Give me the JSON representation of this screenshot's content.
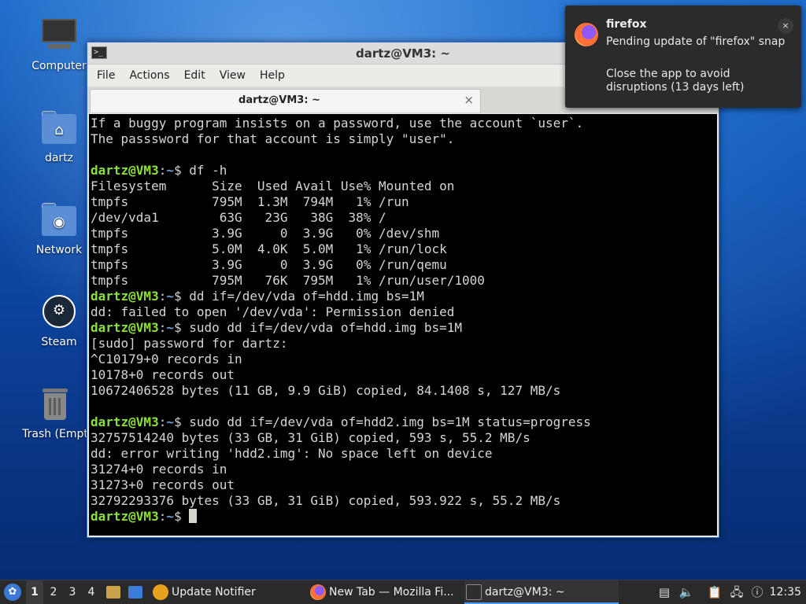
{
  "desktop": {
    "icons": [
      {
        "label": "Computer",
        "icon": "computer-icon"
      },
      {
        "label": "dartz",
        "icon": "home-folder-icon"
      },
      {
        "label": "Network",
        "icon": "network-folder-icon"
      },
      {
        "label": "Steam",
        "icon": "steam-icon"
      },
      {
        "label": "Trash (Empt",
        "icon": "trash-icon"
      }
    ]
  },
  "window": {
    "title": "dartz@VM3: ~",
    "menu": [
      "File",
      "Actions",
      "Edit",
      "View",
      "Help"
    ],
    "tab_label": "dartz@VM3: ~",
    "tab_close": "×"
  },
  "terminal": {
    "prompt_user": "dartz@VM3",
    "prompt_path": "~",
    "lines": [
      {
        "text": "If a buggy program insists on a password, use the account `user`."
      },
      {
        "text": "The passsword for that account is simply \"user\"."
      },
      {
        "text": ""
      },
      {
        "prompt": true,
        "text": " df -h"
      },
      {
        "text": "Filesystem      Size  Used Avail Use% Mounted on"
      },
      {
        "text": "tmpfs           795M  1.3M  794M   1% /run"
      },
      {
        "text": "/dev/vda1        63G   23G   38G  38% /"
      },
      {
        "text": "tmpfs           3.9G     0  3.9G   0% /dev/shm"
      },
      {
        "text": "tmpfs           5.0M  4.0K  5.0M   1% /run/lock"
      },
      {
        "text": "tmpfs           3.9G     0  3.9G   0% /run/qemu"
      },
      {
        "text": "tmpfs           795M   76K  795M   1% /run/user/1000"
      },
      {
        "prompt": true,
        "text": " dd if=/dev/vda of=hdd.img bs=1M"
      },
      {
        "text": "dd: failed to open '/dev/vda': Permission denied"
      },
      {
        "prompt": true,
        "text": " sudo dd if=/dev/vda of=hdd.img bs=1M"
      },
      {
        "text": "[sudo] password for dartz:"
      },
      {
        "text": "^C10179+0 records in"
      },
      {
        "text": "10178+0 records out"
      },
      {
        "text": "10672406528 bytes (11 GB, 9.9 GiB) copied, 84.1408 s, 127 MB/s"
      },
      {
        "text": ""
      },
      {
        "prompt": true,
        "text": " sudo dd if=/dev/vda of=hdd2.img bs=1M status=progress"
      },
      {
        "text": "32757514240 bytes (33 GB, 31 GiB) copied, 593 s, 55.2 MB/s"
      },
      {
        "text": "dd: error writing 'hdd2.img': No space left on device"
      },
      {
        "text": "31274+0 records in"
      },
      {
        "text": "31273+0 records out"
      },
      {
        "text": "32792293376 bytes (33 GB, 31 GiB) copied, 593.922 s, 55.2 MB/s"
      },
      {
        "prompt": true,
        "text": " ",
        "cursor": true
      }
    ]
  },
  "notification": {
    "app": "firefox",
    "line1": "Pending update of \"firefox\" snap",
    "line2": "Close the app to avoid disruptions (13 days left)",
    "close": "×"
  },
  "taskbar": {
    "workspaces": [
      "1",
      "2",
      "3",
      "4"
    ],
    "active_workspace": "1",
    "tasks": [
      {
        "label": "Update Notifier",
        "icon": "update-notifier-icon"
      },
      {
        "label": "New Tab — Mozilla Fi...",
        "icon": "firefox-icon"
      },
      {
        "label": "dartz@VM3: ~",
        "icon": "terminal-icon"
      }
    ],
    "clock": "12:35"
  },
  "colors": {
    "prompt_user": "#8ae234",
    "prompt_path": "#729fcf",
    "terminal_bg": "#000000",
    "terminal_fg": "#d3d7cf",
    "accent": "#2f6fd0"
  }
}
